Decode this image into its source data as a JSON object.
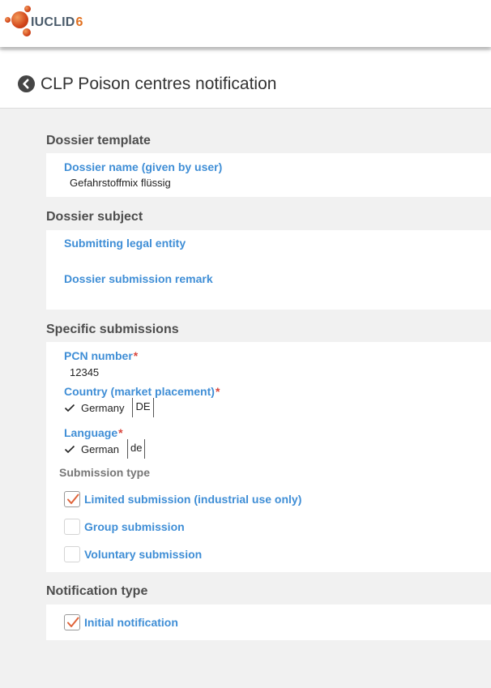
{
  "app": {
    "logo_text": "IUCLID",
    "logo_version": "6",
    "accent_color": "#3f8ed6",
    "required_color": "#d9463d",
    "check_color": "#e0643a"
  },
  "page": {
    "title": "CLP Poison centres notification",
    "back_icon": "chevron-left-circle-icon"
  },
  "dossier_template": {
    "header": "Dossier template",
    "dossier_name_label": "Dossier name (given by user)",
    "dossier_name_value": "Gefahrstoffmix flüssig"
  },
  "dossier_subject": {
    "header": "Dossier subject",
    "legal_entity_label": "Submitting legal entity",
    "remark_label": "Dossier submission remark"
  },
  "specific_submissions": {
    "header": "Specific submissions",
    "pcn_label": "PCN number",
    "required_mark": "*",
    "pcn_value": "12345",
    "country_label": "Country (market placement)",
    "country_value": "Germany",
    "country_code": "DE",
    "language_label": "Language",
    "language_value": "German",
    "language_code": "de",
    "submission_type_label": "Submission type",
    "submission_types": [
      {
        "label": "Limited submission (industrial use only)",
        "checked": true
      },
      {
        "label": "Group submission",
        "checked": false
      },
      {
        "label": "Voluntary submission",
        "checked": false
      }
    ]
  },
  "notification_type": {
    "header": "Notification type",
    "options": [
      {
        "label": "Initial notification",
        "checked": true
      }
    ]
  }
}
